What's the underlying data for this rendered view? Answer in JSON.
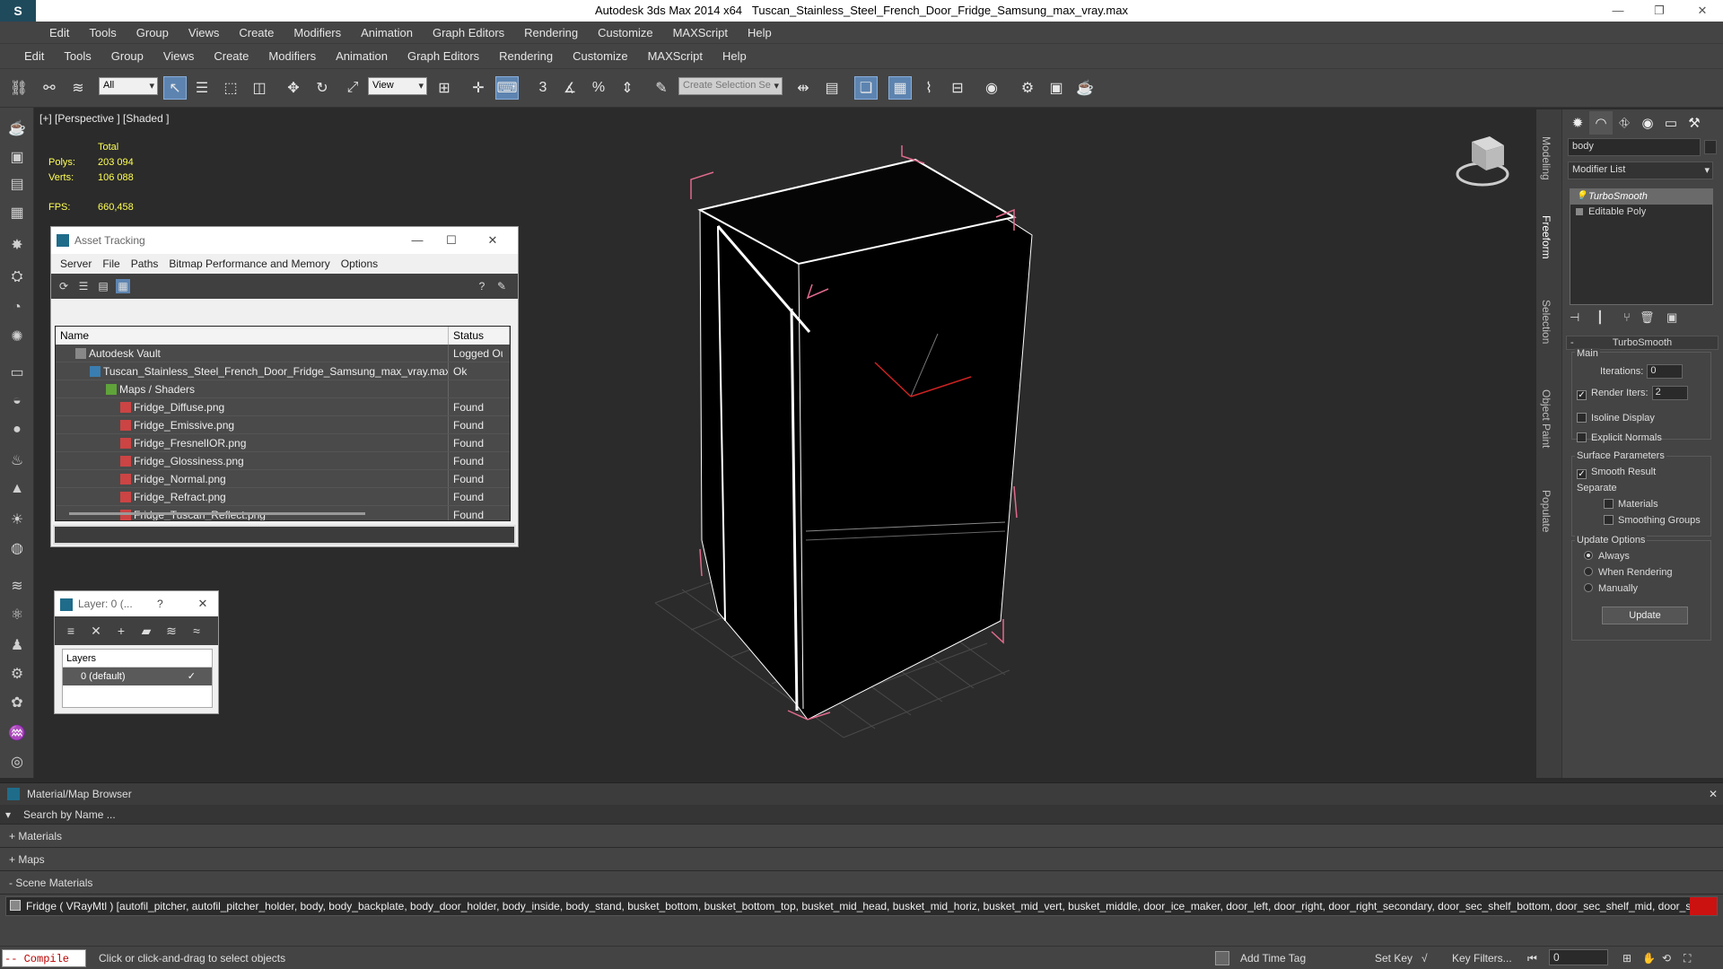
{
  "titlebar": {
    "logo": "S",
    "app": "Autodesk 3ds Max  2014 x64",
    "file": "Tuscan_Stainless_Steel_French_Door_Fridge_Samsung_max_vray.max"
  },
  "menu_top": [
    "Edit",
    "Tools",
    "Group",
    "Views",
    "Create",
    "Modifiers",
    "Animation",
    "Graph Editors",
    "Rendering",
    "Customize",
    "MAXScript",
    "Help"
  ],
  "menu_main": [
    "Edit",
    "Tools",
    "Group",
    "Views",
    "Create",
    "Modifiers",
    "Animation",
    "Graph Editors",
    "Rendering",
    "Customize",
    "MAXScript",
    "Help"
  ],
  "toolbar": {
    "filter_value": "All",
    "refcoord_value": "View",
    "selection_set_placeholder": "Create Selection Se",
    "snap_label": "3"
  },
  "viewport": {
    "label": "[+] [Perspective ] [Shaded ]",
    "stats": {
      "total_label": "Total",
      "polys_label": "Polys:",
      "polys_value": "203 094",
      "verts_label": "Verts:",
      "verts_value": "106 088",
      "fps_label": "FPS:",
      "fps_value": "660,458"
    }
  },
  "asset_tracking": {
    "title": "Asset Tracking",
    "menu": [
      "Server",
      "File",
      "Paths",
      "Bitmap Performance and Memory",
      "Options"
    ],
    "columns": [
      "Name",
      "Status"
    ],
    "rows": [
      {
        "name": "Autodesk Vault",
        "status": "Logged Ou",
        "indent": 0,
        "icon": "vault-icon"
      },
      {
        "name": "Tuscan_Stainless_Steel_French_Door_Fridge_Samsung_max_vray.max",
        "status": "Ok",
        "indent": 1,
        "icon": "max-file-icon"
      },
      {
        "name": "Maps / Shaders",
        "status": "",
        "indent": 2,
        "icon": "maps-folder-icon"
      },
      {
        "name": "Fridge_Diffuse.png",
        "status": "Found",
        "indent": 3,
        "icon": "png-icon"
      },
      {
        "name": "Fridge_Emissive.png",
        "status": "Found",
        "indent": 3,
        "icon": "png-icon"
      },
      {
        "name": "Fridge_FresnelIOR.png",
        "status": "Found",
        "indent": 3,
        "icon": "png-icon"
      },
      {
        "name": "Fridge_Glossiness.png",
        "status": "Found",
        "indent": 3,
        "icon": "png-icon"
      },
      {
        "name": "Fridge_Normal.png",
        "status": "Found",
        "indent": 3,
        "icon": "png-icon"
      },
      {
        "name": "Fridge_Refract.png",
        "status": "Found",
        "indent": 3,
        "icon": "png-icon"
      },
      {
        "name": "Fridge_Tuscan_Reflect.png",
        "status": "Found",
        "indent": 3,
        "icon": "png-icon"
      }
    ]
  },
  "layer_dialog": {
    "title": "Layer: 0 (...",
    "help": "?",
    "column": "Layers",
    "layer_name": "0 (default)"
  },
  "side_tabs": [
    "Modeling",
    "Freeform",
    "Selection",
    "Object Paint",
    "Populate"
  ],
  "command_panel": {
    "object_name": "body",
    "modifier_list": "Modifier List",
    "stack": [
      "TurboSmooth",
      "Editable Poly"
    ],
    "turbosmooth": {
      "title": "TurboSmooth",
      "main": "Main",
      "iterations_label": "Iterations:",
      "iterations_value": "0",
      "render_iters_label": "Render Iters:",
      "render_iters_value": "2",
      "isoline": "Isoline Display",
      "explicit_normals": "Explicit Normals",
      "surface_params": "Surface Parameters",
      "smooth_result": "Smooth Result",
      "separate": "Separate",
      "materials": "Materials",
      "smoothing_groups": "Smoothing Groups",
      "update_options": "Update Options",
      "always": "Always",
      "when_rendering": "When Rendering",
      "manually": "Manually",
      "update_button": "Update"
    }
  },
  "material_browser": {
    "title": "Material/Map Browser",
    "search_placeholder": "Search by Name ...",
    "groups": [
      "+ Materials",
      "+ Maps",
      "- Scene Materials"
    ],
    "material_row": "Fridge ( VRayMtl ) [autofil_pitcher, autofil_pitcher_holder, body, body_backplate, body_door_holder, body_inside, body_stand, busket_bottom, busket_bottom_top, busket_mid_head, busket_mid_horiz, busket_mid_vert, busket_middle, door_ice_maker, door_left, door_right, door_right_secondary, door_sec_shelf_bottom, door_sec_shelf_mid, door_sec_shelf_top, do..."
  },
  "statusbar": {
    "compile": "-- Compile e:",
    "prompt": "Click or click-and-drag to select objects",
    "add_time_tag": "Add Time Tag",
    "set_key": "Set Key",
    "key_filters": "Key Filters...",
    "frame_value": "0"
  },
  "colors": {
    "panel": "#444444",
    "viewport": "#2b2b2b",
    "selection_bracket": "#e06a8c",
    "stats_text": "#ffff55",
    "active_button": "#5d84b0"
  }
}
